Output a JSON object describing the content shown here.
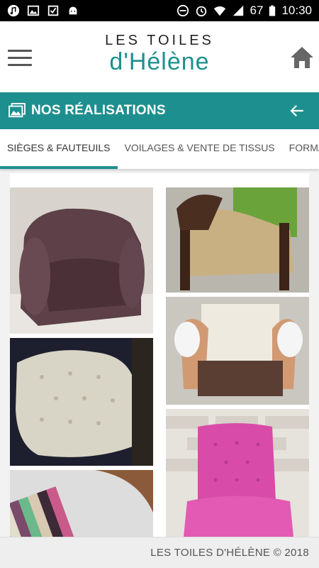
{
  "status_bar": {
    "battery": "67",
    "time": "10:30"
  },
  "header": {
    "logo_top": "LES TOILES",
    "logo_bottom": "d'Hélène",
    "brand_color": "#1e8f8f"
  },
  "section": {
    "title": "NOS RÉALISATIONS"
  },
  "tabs": [
    {
      "label": "SIÈGES & FAUTEUILS",
      "active": true
    },
    {
      "label": "VOILAGES & VENTE DE TISSUS",
      "active": false
    },
    {
      "label": "FORMA",
      "active": false
    }
  ],
  "gallery": {
    "photos": [
      {
        "subject": "brown-leather-club-armchair"
      },
      {
        "subject": "green-armchair-stripped"
      },
      {
        "subject": "tufted-seat-cushion"
      },
      {
        "subject": "armchair-padding"
      },
      {
        "subject": "striped-chair"
      },
      {
        "subject": "pink-tufted-chair"
      }
    ]
  },
  "footer": {
    "copyright": "LES TOILES D'HÉLÈNE © 2018"
  }
}
